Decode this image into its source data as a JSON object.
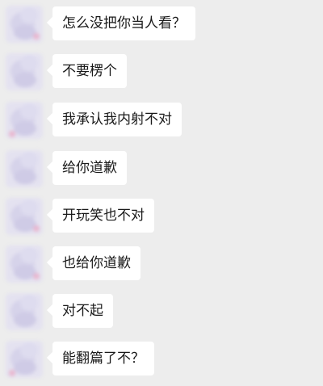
{
  "messages": [
    {
      "text": "怎么没把你当人看？"
    },
    {
      "text": "不要楞个"
    },
    {
      "text": "我承认我内射不对"
    },
    {
      "text": "给你道歉"
    },
    {
      "text": "开玩笑也不对"
    },
    {
      "text": "也给你道歉"
    },
    {
      "text": "对不起"
    },
    {
      "text": "能翻篇了不？"
    }
  ]
}
